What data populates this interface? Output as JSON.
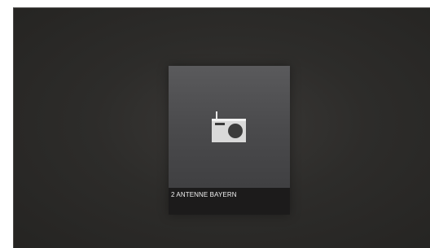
{
  "tiles": [
    {
      "label": "2 ANTENNE BAYERN",
      "icon": "radio-icon"
    }
  ]
}
